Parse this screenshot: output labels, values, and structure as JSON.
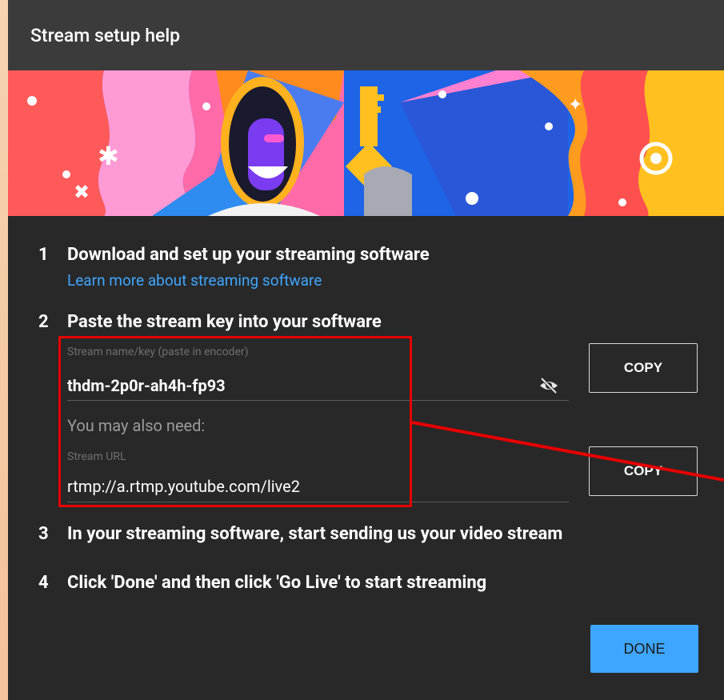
{
  "dialog": {
    "title": "Stream setup help"
  },
  "steps": [
    {
      "num": "1",
      "text": "Download and set up your streaming software"
    },
    {
      "num": "2",
      "text": "Paste the stream key into your software"
    },
    {
      "num": "3",
      "text": "In your streaming software, start sending us your video stream"
    },
    {
      "num": "4",
      "text": "Click 'Done' and then click 'Go Live' to start streaming"
    }
  ],
  "learn_link": "Learn more about streaming software",
  "stream_key": {
    "label": "Stream name/key (paste in encoder)",
    "value": "thdm-2p0r-ah4h-fp93",
    "copy_label": "COPY"
  },
  "also_need": "You may also need:",
  "stream_url": {
    "label": "Stream URL",
    "value": "rtmp://a.rtmp.youtube.com/live2",
    "copy_label": "COPY"
  },
  "done_label": "DONE",
  "colors": {
    "dialog_bg": "#282828",
    "title_bg": "#3b3b3b",
    "accent": "#3ea6ff",
    "annotation": "#e60000"
  }
}
